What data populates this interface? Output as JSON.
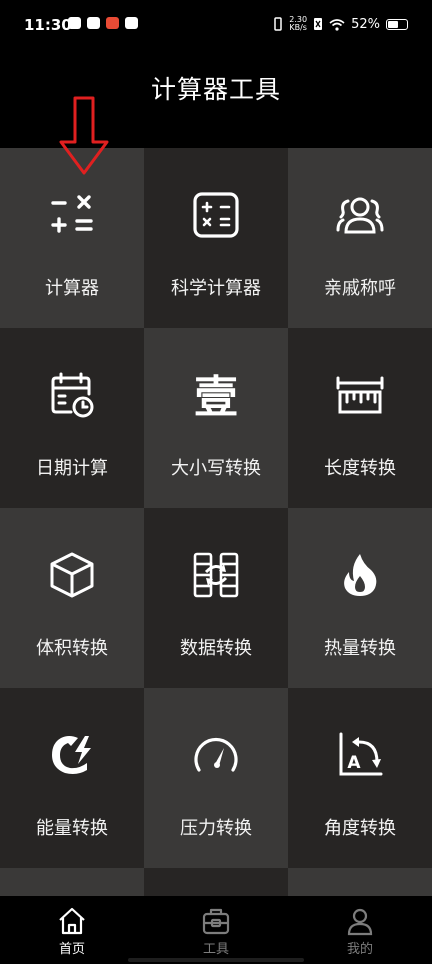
{
  "status": {
    "time": "11:30",
    "net_speed_value": "2.30",
    "net_speed_unit": "KB/s",
    "battery": "52%"
  },
  "header": {
    "title": "计算器工具"
  },
  "tools": [
    {
      "label": "计算器",
      "icon": "calculator-symbols-icon"
    },
    {
      "label": "科学计算器",
      "icon": "scientific-calculator-icon"
    },
    {
      "label": "亲戚称呼",
      "icon": "relatives-icon"
    },
    {
      "label": "日期计算",
      "icon": "calendar-clock-icon"
    },
    {
      "label": "大小写转换",
      "icon": "chinese-numeral-icon",
      "glyph": "壹"
    },
    {
      "label": "长度转换",
      "icon": "ruler-icon"
    },
    {
      "label": "体积转换",
      "icon": "cube-icon"
    },
    {
      "label": "数据转换",
      "icon": "data-convert-icon"
    },
    {
      "label": "热量转换",
      "icon": "flame-icon"
    },
    {
      "label": "能量转换",
      "icon": "energy-icon"
    },
    {
      "label": "压力转换",
      "icon": "gauge-icon"
    },
    {
      "label": "角度转换",
      "icon": "angle-icon",
      "glyph": "A"
    }
  ],
  "nav": {
    "items": [
      {
        "label": "首页",
        "icon": "home-icon",
        "active": true
      },
      {
        "label": "工具",
        "icon": "toolbox-icon",
        "active": false
      },
      {
        "label": "我的",
        "icon": "profile-icon",
        "active": false
      }
    ]
  },
  "colors": {
    "tile_light": "#3a3938",
    "tile_dark": "#272524",
    "annotation_arrow": "#e02020",
    "nav_inactive": "#7d7d7d"
  }
}
